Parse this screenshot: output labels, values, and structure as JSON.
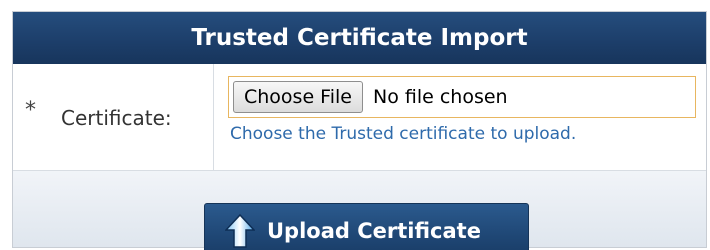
{
  "panel": {
    "title": "Trusted Certificate Import"
  },
  "form": {
    "required_mark": "*",
    "certificate_label": "Certificate:",
    "file_button_label": "Choose File",
    "file_status": "No file chosen",
    "hint": "Choose the Trusted certificate to upload."
  },
  "footer": {
    "upload_label": "Upload Certificate",
    "upload_icon": "arrow-up-icon"
  },
  "colors": {
    "header": "#1d3f6b",
    "hint_text": "#2e6aab",
    "input_border": "#e8b660"
  }
}
